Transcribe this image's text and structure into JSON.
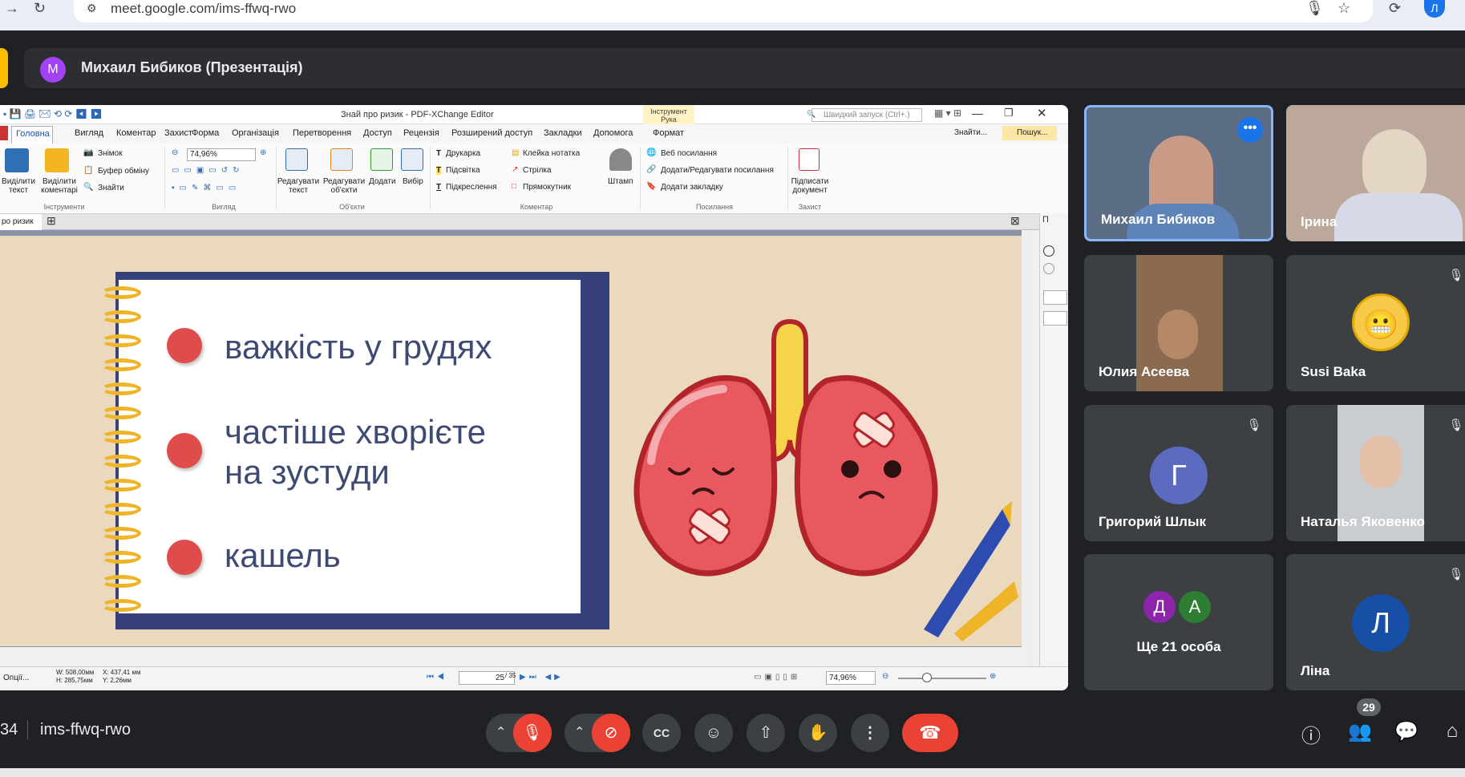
{
  "browser": {
    "url": "meet.google.com/ims-ffwq-rwo",
    "profile_initial": "Л",
    "icons": [
      "back-icon",
      "reload-icon",
      "site-info-icon",
      "mic-icon",
      "star-icon",
      "extension-icon",
      "profile-avatar"
    ]
  },
  "presenter_banner": {
    "avatar_initial": "M",
    "text": "Михаил Бибиков (Презентація)"
  },
  "pdf_editor": {
    "window_title": "Знай про ризик - PDF-XChange Editor",
    "quick_search_placeholder": "Швидкий запуск (Ctrl+.)",
    "context_group": "Інструмент Рука",
    "menu": [
      "Головна",
      "Вигляд",
      "Коментар",
      "Захист",
      "Форма",
      "Організація",
      "Перетворення",
      "Доступ",
      "Рецензія",
      "Розширений доступ",
      "Закладки",
      "Допомога",
      "Формат"
    ],
    "active_menu": "Головна",
    "find_label": "Знайти...",
    "search_label": "Пошук...",
    "ribbon": {
      "select_text": "Виділити текст",
      "select_comments": "Виділити коментарі",
      "snapshot": "Знімок",
      "clipboard": "Буфер обміну",
      "find": "Знайти",
      "zoom": "74,96%",
      "edit_text": "Редагувати текст",
      "edit_objects": "Редагувати об'єкти",
      "add": "Додати",
      "choose": "Вибір",
      "typewriter": "Друкарка",
      "highlight": "Підсвітка",
      "underline": "Підкреслення",
      "sticky_note": "Клейка нотатка",
      "arrow": "Стрілка",
      "rectangle": "Прямокутник",
      "stamp": "Штамп",
      "web_links": "Веб посилання",
      "add_edit_links": "Додати/Редагувати посилання",
      "add_bookmark": "Додати закладку",
      "sign_document": "Підписати документ",
      "groups": [
        "Інструменти",
        "Вигляд",
        "Об'єкти",
        "Коментар",
        "Посилання",
        "Захист"
      ]
    },
    "doc_tab": "ро ризик",
    "side_panel_letter": "П",
    "status": {
      "options": "Опції...",
      "width": "W: 508,00мм",
      "height": "H: 285,75мм",
      "x": "X: 437,41 мм",
      "y": "Y: 2,26мм",
      "page": "25",
      "total": "/ 35",
      "zoom": "74,96%"
    }
  },
  "slide": {
    "bullets": [
      "важкість у грудях",
      "частіше хворієте\nна зустуди",
      "кашель"
    ],
    "accent": "#e04b4b",
    "text_color": "#3f4a74",
    "notebook_border": "#36407b",
    "spiral": "#f0b429"
  },
  "participants": [
    {
      "name": "Михаил Бибиков",
      "type": "video",
      "active_speaker": true,
      "more_icon": "more-horiz-icon"
    },
    {
      "name": "Ірина",
      "type": "video"
    },
    {
      "name": "Юлия Асеева",
      "type": "video"
    },
    {
      "name": "Susi Baka",
      "type": "emoji-avatar",
      "muted": true
    },
    {
      "name": "Григорий Шлык",
      "type": "initial",
      "initial": "Г",
      "color": "#5c6bc0",
      "muted": true
    },
    {
      "name": "Наталья Яковенко",
      "type": "video",
      "muted": true
    },
    {
      "name": "Ще 21 особа",
      "type": "group",
      "initials": [
        "Д",
        "А"
      ],
      "colors": [
        "#8e24aa",
        "#2e7d32"
      ]
    },
    {
      "name": "Ліна",
      "type": "initial",
      "initial": "Л",
      "color": "#174ea6",
      "muted": true
    }
  ],
  "bottom_bar": {
    "time_fragment": "34",
    "meeting_code": "ims-ffwq-rwo",
    "participant_count": "29",
    "controls": [
      "mic-off",
      "camera-off",
      "captions",
      "emoji",
      "present",
      "raise-hand",
      "more-options",
      "leave-call"
    ],
    "right_controls": [
      "info",
      "people",
      "chat",
      "activities"
    ]
  }
}
